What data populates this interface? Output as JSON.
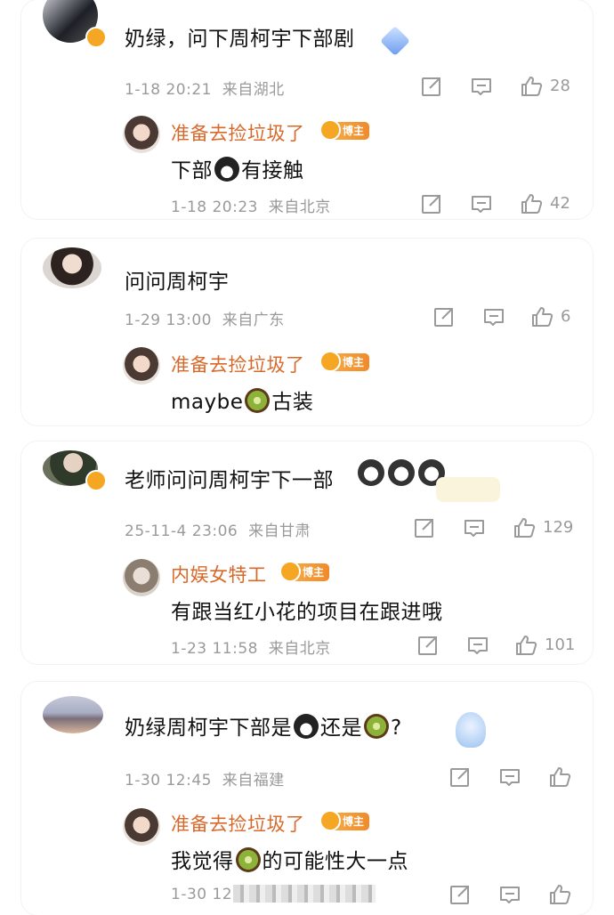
{
  "threads": [
    {
      "top": {
        "text": "奶绿，问下周柯宇下部剧",
        "time": "1-18 20:21",
        "loc": "来自湖北",
        "likes": "28"
      },
      "reply": {
        "name": "准备去捡垃圾了",
        "badge": "博主",
        "pre": "下部",
        "emoji": "penguin",
        "post": "有接触",
        "time": "1-18 20:23",
        "loc": "来自北京",
        "likes": "42"
      }
    },
    {
      "top": {
        "text": "问问周柯宇",
        "time": "1-29 13:00",
        "loc": "来自广东",
        "likes": "6"
      },
      "reply": {
        "name": "准备去捡垃圾了",
        "badge": "博主",
        "pre": "maybe",
        "emoji": "kiwi",
        "post": "古装"
      }
    },
    {
      "top": {
        "text": "老师问问周柯宇下一部",
        "time": "25-11-4 23:06",
        "loc": "来自甘肃",
        "likes": "129"
      },
      "reply": {
        "name": "内娱女特工",
        "badge": "博主",
        "text": "有跟当红小花的项目在跟进哦",
        "time": "1-23 11:58",
        "loc": "来自北京",
        "likes": "101"
      }
    },
    {
      "top": {
        "pre": "奶绿周柯宇下部是",
        "mid": "还是",
        "post": "?",
        "time": "1-30 12:45",
        "loc": "来自福建"
      },
      "reply": {
        "name": "准备去捡垃圾了",
        "badge": "博主",
        "pre": "我觉得",
        "post": "的可能性大一点",
        "time": "1-30 12"
      }
    }
  ],
  "icons": {
    "share": "share-icon",
    "comment": "comment-icon",
    "like": "thumbs-up-icon",
    "verified": "verified-badge-icon"
  },
  "colors": {
    "username": "#d9692a",
    "meta": "#9a9a9a",
    "badge": "#f08a2a"
  }
}
